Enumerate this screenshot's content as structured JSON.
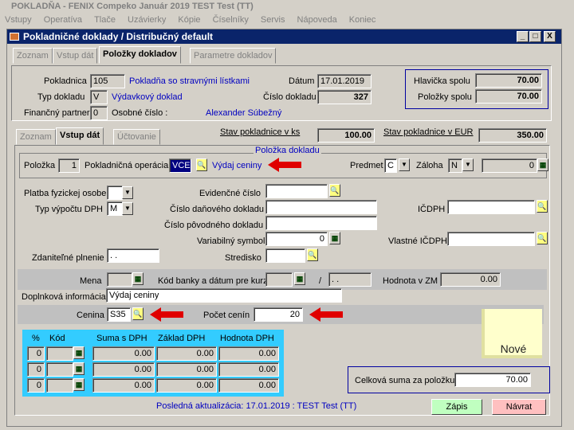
{
  "app": {
    "title": "POKLADŇA - FENIX Compeko   Január 2019   TEST Test  (TT)",
    "menu": [
      "Vstupy",
      "Operatíva",
      "Tlače",
      "Uzávierky",
      "Kópie",
      "Číselníky",
      "Servis",
      "Nápoveda",
      "Koniec"
    ]
  },
  "window": {
    "title": "Pokladničné doklady / Distribučný default",
    "min": "_",
    "max": "□",
    "close": "X"
  },
  "tabs": [
    "Zoznam",
    "Vstup dát",
    "Položky dokladov",
    "Parametre dokladov"
  ],
  "header": {
    "pokladnica_label": "Pokladnica",
    "pokladnica_value": "105",
    "pokladnica_desc": "Pokladňa so stravnými lístkami",
    "typ_label": "Typ dokladu",
    "typ_value": "V",
    "typ_desc": "Výdavkový doklad",
    "partner_label": "Finančný partner",
    "partner_value": "0",
    "osobne_label": "Osobné číslo :",
    "osobne_value": "Alexander Súbežný",
    "datum_label": "Dátum",
    "datum_value": "17.01.2019",
    "cislo_label": "Číslo dokladu",
    "cislo_value": "327",
    "hlavicka_label": "Hlavička spolu",
    "hlavicka_value": "70.00",
    "polozky_label": "Položky spolu",
    "polozky_value": "70.00"
  },
  "subtabs": [
    "Zoznam",
    "Vstup dát",
    "Účtovanie"
  ],
  "stav": {
    "sk_label": "Stav pokladnice v ks",
    "sk_value": "100.00",
    "eur_label": "Stav pokladnice v EUR",
    "eur_value": "350.00"
  },
  "polozka": {
    "group_title": "Položka dokladu",
    "polozka_label": "Položka",
    "polozka_value": "1",
    "operacia_label": "Pokladničná operácia",
    "operacia_value": "VCE",
    "operacia_desc": "Výdaj ceniny",
    "predmet_label": "Predmet",
    "predmet_value": "C",
    "zaloha_label": "Záloha",
    "zaloha_value": "N",
    "zaloha_num": "0"
  },
  "form": {
    "platba_label": "Platba fyzickej osobe",
    "typ_dph_label": "Typ výpočtu DPH",
    "typ_dph_value": "M",
    "evid_label": "Evidenčné číslo",
    "dan_label": "Číslo daňového dokladu",
    "povod_label": "Číslo pôvodného dokladu",
    "varsym_label": "Variabilný symbol",
    "varsym_value": "0",
    "stredisko_label": "Stredisko",
    "zdanit_label": "Zdaniteľné plnenie",
    "zdanit_value": " .  .",
    "icdph_label": "IČDPH",
    "vlast_label": "Vlastné IČDPH",
    "mena_label": "Mena",
    "kod_banky_label": "Kód banky a dátum pre kurz",
    "kurz_date": " .  .",
    "slash": "/",
    "hodnota_zm_label": "Hodnota v ZM",
    "hodnota_zm_value": "0.00",
    "doplnkova_label": "Doplnková informácia",
    "doplnkova_value": "Výdaj ceniny",
    "cenina_label": "Cenina",
    "cenina_value": "S35",
    "pocet_label": "Počet cenín",
    "pocet_value": "20"
  },
  "dph_table": {
    "headers": [
      "%",
      "Kód",
      "Suma s DPH",
      "Základ DPH",
      "Hodnota DPH"
    ],
    "rows": [
      [
        "0",
        "",
        "0.00",
        "0.00",
        "0.00"
      ],
      [
        "0",
        "",
        "0.00",
        "0.00",
        "0.00"
      ],
      [
        "0",
        "",
        "0.00",
        "0.00",
        "0.00"
      ]
    ]
  },
  "sticky_note": "Nové",
  "total": {
    "label": "Celková suma za položku",
    "value": "70.00"
  },
  "footer": {
    "last_update": "Posledná aktualizácia: 17.01.2019 : TEST Test  (TT)",
    "zapis": "Zápis",
    "navrat": "Návrat"
  },
  "colors": {
    "title_blue": "#0a246a",
    "arrow_red": "#e00000",
    "table_bg": "#33ccff",
    "zapis_bg": "#c0ffc0",
    "navrat_bg": "#ffc0c0"
  }
}
